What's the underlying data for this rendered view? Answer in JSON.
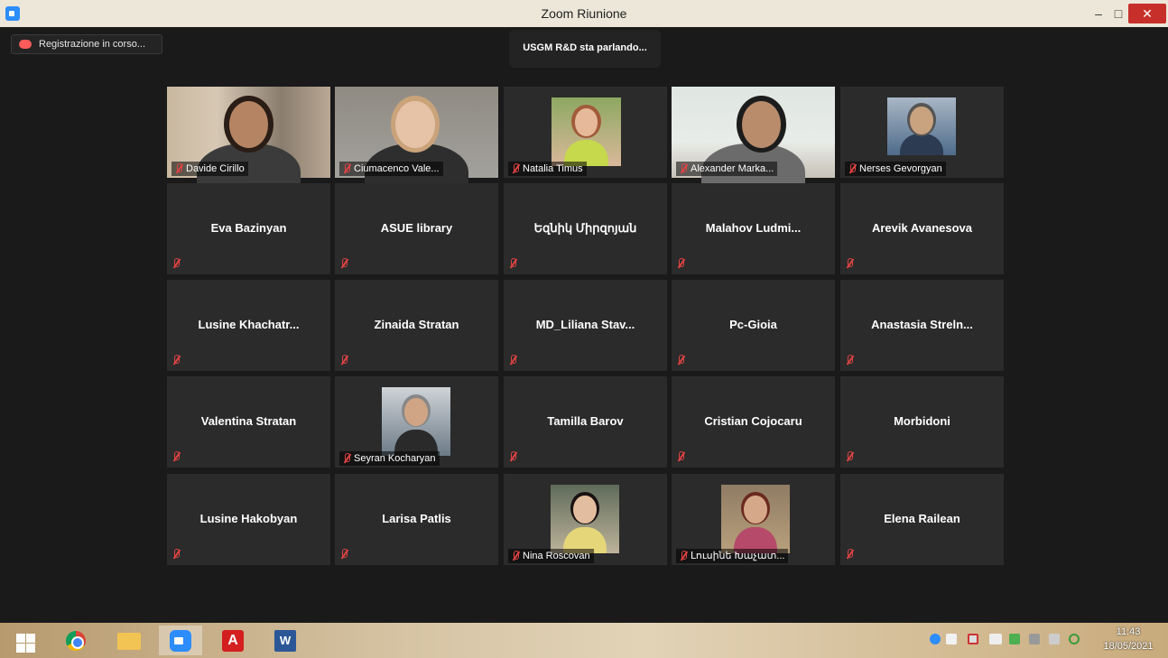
{
  "window": {
    "title": "Zoom Riunione",
    "min_label": "–",
    "max_label": "□",
    "close_label": "✕"
  },
  "recording": {
    "label": "Registrazione in corso..."
  },
  "speaker_banner": {
    "label": "USGM R&D sta parlando..."
  },
  "participants": [
    {
      "name": "Davide Cirillo",
      "video": true
    },
    {
      "name": "Ciumacenco Vale...",
      "video": true
    },
    {
      "name": "Natalia Timus",
      "video": true
    },
    {
      "name": "Alexander Marka...",
      "video": true
    },
    {
      "name": "Nerses Gevorgyan",
      "video": true
    },
    {
      "name": "Eva Bazinyan",
      "video": false
    },
    {
      "name": "ASUE library",
      "video": false
    },
    {
      "name": "Եզնիկ Միրզոյան",
      "video": false
    },
    {
      "name": "Malahov  Ludmi...",
      "video": false
    },
    {
      "name": "Arevik Avanesova",
      "video": false
    },
    {
      "name": "Lusine  Khachatr...",
      "video": false
    },
    {
      "name": "Zinaida Stratan",
      "video": false
    },
    {
      "name": "MD_Liliana  Stav...",
      "video": false
    },
    {
      "name": "Pc-Gioia",
      "video": false
    },
    {
      "name": "Anastasia  Streln...",
      "video": false
    },
    {
      "name": "Valentina Stratan",
      "video": false
    },
    {
      "name": "Seyran Kocharyan",
      "video": true
    },
    {
      "name": "Tamilla Barov",
      "video": false
    },
    {
      "name": "Cristian Cojocaru",
      "video": false
    },
    {
      "name": "Morbidoni",
      "video": false
    },
    {
      "name": "Lusine Hakobyan",
      "video": false
    },
    {
      "name": "Larisa Patlis",
      "video": false
    },
    {
      "name": "Nina Roscovan",
      "video": true
    },
    {
      "name": "Լուսինե Խաչատ...",
      "video": true
    },
    {
      "name": "Elena Railean",
      "video": false
    }
  ],
  "taskbar": {
    "apps": [
      "windows-start",
      "chrome",
      "file-explorer",
      "zoom",
      "acrobat",
      "word"
    ],
    "acrobat_glyph": "A",
    "word_glyph": "W",
    "clock": {
      "time": "11:43",
      "date": "18/05/2021"
    }
  },
  "colors": {
    "accent": "#2d8cff",
    "mute": "#e04343",
    "close": "#c7302a",
    "tile": "#2b2b2b"
  }
}
